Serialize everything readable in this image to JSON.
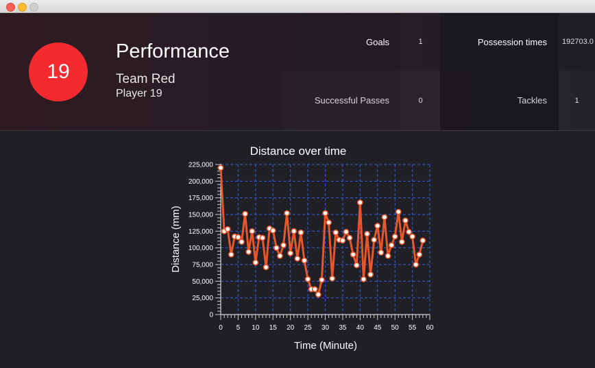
{
  "window": {
    "buttons": {
      "close": "close",
      "minimize": "minimize",
      "maximize": "maximize"
    }
  },
  "header": {
    "player_number": "19",
    "title": "Performance",
    "team": "Team Red",
    "player": "Player 19",
    "badge_color": "#f42a2e"
  },
  "stats": {
    "goals_label": "Goals",
    "goals_value": "1",
    "possession_label": "Possession times",
    "possession_value": "192703.0",
    "passes_label": "Successful Passes",
    "passes_value": "0",
    "tackles_label": "Tackles",
    "tackles_value": "1"
  },
  "chart_data": {
    "type": "line",
    "title": "Distance over time",
    "xlabel": "Time (Minute)",
    "ylabel": "Distance (mm)",
    "xlim": [
      0,
      60
    ],
    "ylim": [
      0,
      225000
    ],
    "x_ticks": [
      "0",
      "5",
      "10",
      "15",
      "20",
      "25",
      "30",
      "35",
      "40",
      "45",
      "50",
      "55",
      "60"
    ],
    "y_ticks": [
      "0",
      "25,000",
      "50,000",
      "75,000",
      "100,000",
      "125,000",
      "150,000",
      "175,000",
      "200,000",
      "225,000"
    ],
    "grid": true,
    "line_color": "#e8572a",
    "grid_color": "#2f5fe0",
    "series": [
      {
        "x": [
          0,
          1,
          2,
          3,
          4,
          5,
          6,
          7,
          8,
          9,
          10,
          11,
          12,
          13,
          14,
          15,
          16,
          17,
          18,
          19,
          20,
          21,
          22,
          23,
          24,
          25,
          26,
          27,
          28,
          29,
          30,
          31,
          32,
          33,
          34,
          35,
          36,
          37,
          38,
          39,
          40,
          41,
          42,
          43,
          44,
          45,
          46,
          47,
          48,
          49,
          50,
          51,
          52,
          53,
          54,
          55,
          56,
          57,
          58,
          59
        ],
        "values": [
          220000,
          125000,
          128000,
          90000,
          117000,
          116000,
          109000,
          151000,
          94000,
          125000,
          78000,
          116000,
          115000,
          71000,
          129000,
          126000,
          100000,
          88000,
          104000,
          152000,
          92000,
          125000,
          84000,
          123000,
          81000,
          53000,
          38000,
          38000,
          30000,
          52000,
          152000,
          138000,
          54000,
          123000,
          112000,
          111000,
          124000,
          115000,
          90000,
          74000,
          168000,
          53000,
          121000,
          60000,
          112000,
          133000,
          93000,
          146000,
          88000,
          104000,
          117000,
          154000,
          109000,
          141000,
          124000,
          117000,
          75000,
          90000,
          111000,
          null
        ]
      }
    ]
  }
}
